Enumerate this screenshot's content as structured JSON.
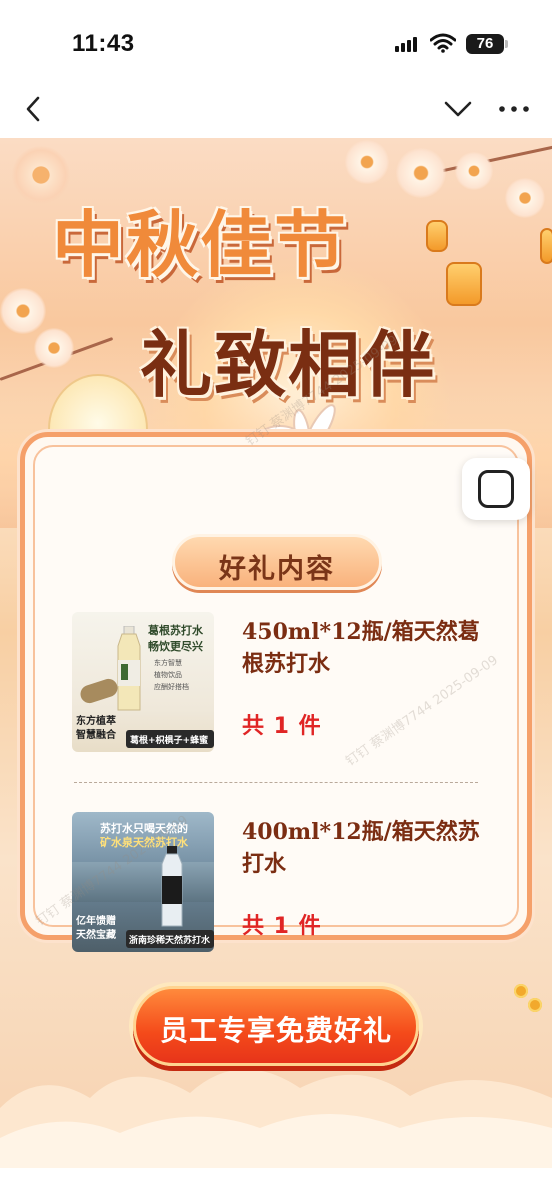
{
  "status_bar": {
    "time": "11:43",
    "battery": "76"
  },
  "nav": {
    "back_icon": "chevron-left-icon",
    "collapse_icon": "chevron-down-icon",
    "more_icon": "more-horizontal-icon"
  },
  "poster": {
    "title_line_1": "中秋佳节",
    "title_line_2": "礼致相伴",
    "section_header": "好礼内容",
    "products": [
      {
        "name": "450ml*12瓶/箱天然葛根苏打水",
        "quantity": "共 1 件",
        "image_texts": {
          "headline_1": "葛根苏打水",
          "headline_2": "畅饮更尽兴",
          "bullets": [
            "东方智慧",
            "植物饮品",
            "应酬好搭档"
          ],
          "left_caption_1": "东方植萃",
          "left_caption_2": "智慧融合",
          "bar_text": "葛根+枳椇子+蜂蜜"
        }
      },
      {
        "name": "400ml*12瓶/箱天然苏打水",
        "quantity": "共 1 件",
        "image_texts": {
          "headline_1": "苏打水只喝天然的",
          "headline_2": "矿水泉天然苏打水",
          "left_caption_1": "亿年馈赠",
          "left_caption_2": "天然宝藏",
          "bar_text": "浙南珍稀天然苏打水"
        }
      }
    ],
    "cta_label": "员工专享免费好礼"
  },
  "watermark_text": "钉钉 蔡渊博7744 2025-09-09",
  "colors": {
    "accent_orange": "#f08a3a",
    "title_brown": "#7a2e12",
    "qty_red": "#e02525",
    "cta_red": "#f44a1a"
  }
}
